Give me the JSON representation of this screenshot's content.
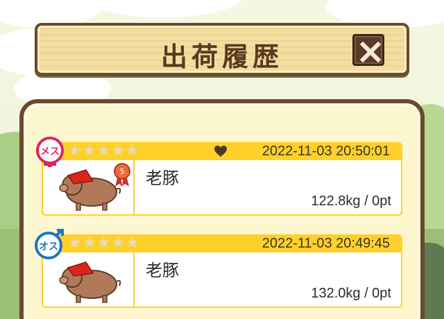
{
  "header": {
    "title": "出荷履歴",
    "close_icon": "close-x-icon"
  },
  "records": [
    {
      "gender_label": "メス",
      "gender_color": "#e0245e",
      "stars": 5,
      "favorite": true,
      "has_medal": true,
      "medal_label": "5",
      "datetime": "2022-11-03 20:50:01",
      "name": "老豚",
      "weight_points": "122.8kg / 0pt"
    },
    {
      "gender_label": "オス",
      "gender_color": "#1f73c4",
      "stars": 5,
      "favorite": false,
      "has_medal": false,
      "datetime": "2022-11-03 20:49:45",
      "name": "老豚",
      "weight_points": "132.0kg / 0pt"
    }
  ],
  "colors": {
    "accent": "#ffd02a",
    "frame": "#6b4a2b",
    "panel": "#fdf7cf"
  }
}
